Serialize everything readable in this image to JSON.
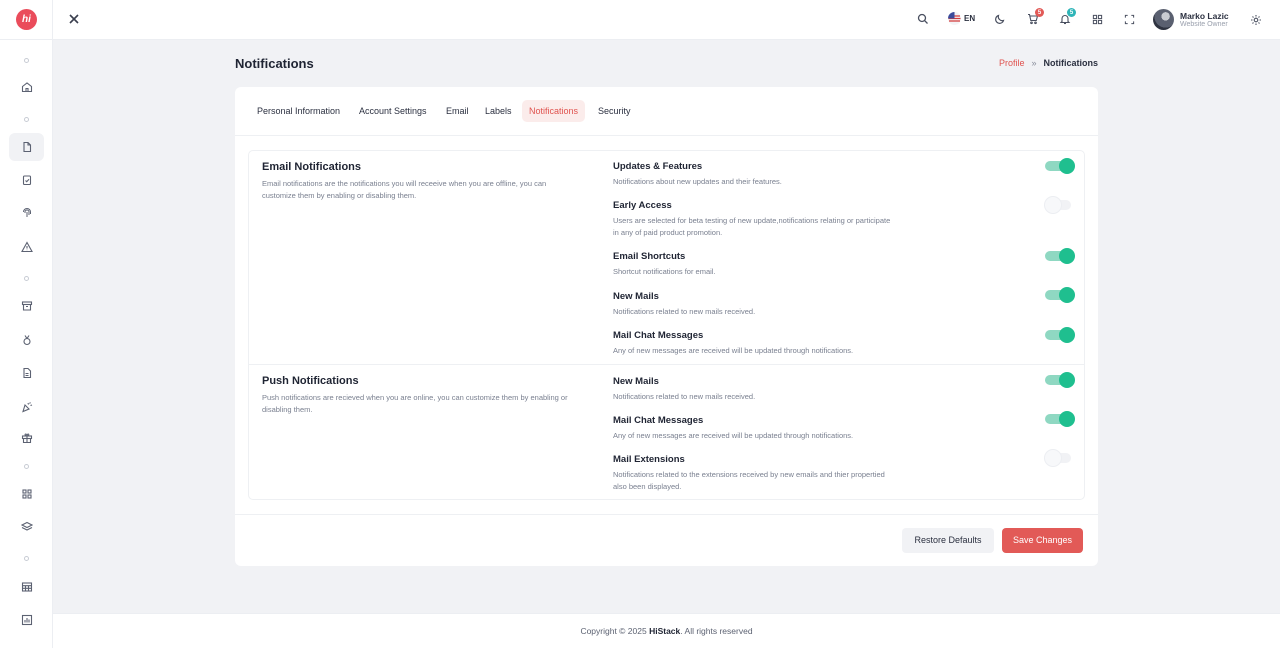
{
  "app": {
    "logo_text": "hi",
    "brand": "HiStack"
  },
  "header": {
    "language": "EN",
    "cart_count": "5",
    "notif_count": "5",
    "user_name": "Marko Lazic",
    "user_role": "Website Owner"
  },
  "page": {
    "title": "Notifications"
  },
  "breadcrumb": {
    "parent": "Profile",
    "separator": "»",
    "current": "Notifications"
  },
  "tabs": [
    {
      "label": "Personal Information"
    },
    {
      "label": "Account Settings"
    },
    {
      "label": "Email"
    },
    {
      "label": "Labels"
    },
    {
      "label": "Notifications",
      "active": true
    },
    {
      "label": "Security"
    }
  ],
  "email_section": {
    "title": "Email Notifications",
    "description": "Email notifications are the notifications you will receeive when you are offline, you can customize them by enabling or disabling them.",
    "items": [
      {
        "title": "Updates & Features",
        "desc": "Notifications about new updates and their features.",
        "enabled": true
      },
      {
        "title": "Early Access",
        "desc": "Users are selected for beta testing of new update,notifications relating or participate in any of paid product promotion.",
        "enabled": false
      },
      {
        "title": "Email Shortcuts",
        "desc": "Shortcut notifications for email.",
        "enabled": true
      },
      {
        "title": "New Mails",
        "desc": "Notifications related to new mails received.",
        "enabled": true
      },
      {
        "title": "Mail Chat Messages",
        "desc": "Any of new messages are received will be updated through notifications.",
        "enabled": true
      }
    ]
  },
  "push_section": {
    "title": "Push Notifications",
    "description": "Push notifications are recieved when you are online, you can customize them by enabling or disabling them.",
    "items": [
      {
        "title": "New Mails",
        "desc": "Notifications related to new mails received.",
        "enabled": true
      },
      {
        "title": "Mail Chat Messages",
        "desc": "Any of new messages are received will be updated through notifications.",
        "enabled": true
      },
      {
        "title": "Mail Extensions",
        "desc": "Notifications related to the extensions received by new emails and thier propertied also been displayed.",
        "enabled": false
      }
    ]
  },
  "actions": {
    "restore": "Restore Defaults",
    "save": "Save Changes"
  },
  "footer": {
    "prefix": "Copyright © 2025",
    "brand": "HiStack",
    "suffix": ". All rights reserved"
  },
  "colors": {
    "accent": "#e25a57",
    "toggle_on": "#1fbf8f",
    "brand": "#ea4c5b"
  }
}
